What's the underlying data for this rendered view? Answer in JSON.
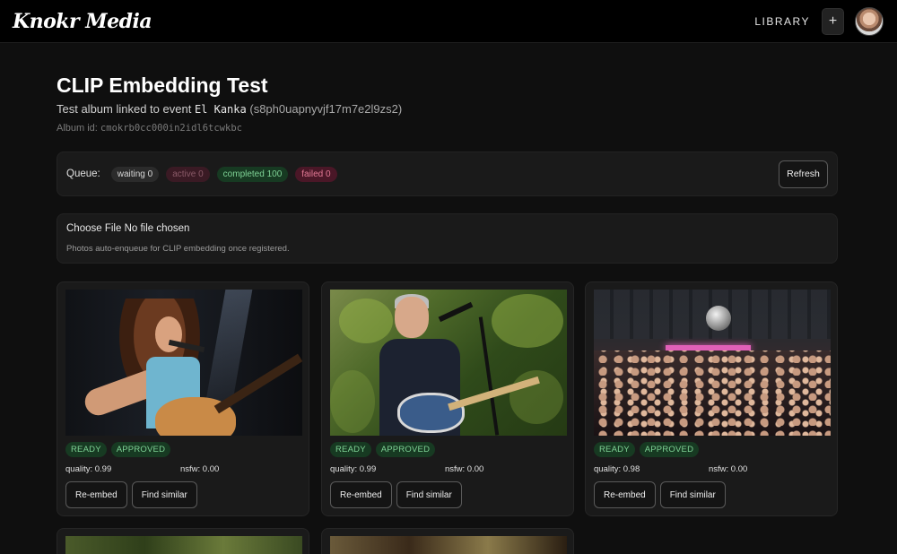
{
  "header": {
    "logo": "Knokr Media",
    "nav_library": "LIBRARY",
    "plus_label": "+"
  },
  "page": {
    "title": "CLIP Embedding Test",
    "subtitle_prefix": "Test album linked to event",
    "event_name": "El Kanka",
    "event_id": "(s8ph0uapnyvjf17m7e2l9zs2)",
    "album_id_label": "Album id:",
    "album_id": "cmokrb0cc000in2idl6tcwkbc"
  },
  "queue": {
    "label": "Queue:",
    "waiting": "waiting 0",
    "active": "active 0",
    "completed": "completed 100",
    "failed": "failed 0",
    "refresh_label": "Refresh"
  },
  "upload": {
    "choose_file": "Choose File",
    "no_file": "No file chosen",
    "hint": "Photos auto-enqueue for CLIP embedding once registered."
  },
  "cards": [
    {
      "status": "READY",
      "moderation": "APPROVED",
      "quality": "quality: 0.99",
      "nsfw": "nsfw: 0.00",
      "reembed": "Re-embed",
      "similar": "Find similar"
    },
    {
      "status": "READY",
      "moderation": "APPROVED",
      "quality": "quality: 0.99",
      "nsfw": "nsfw: 0.00",
      "reembed": "Re-embed",
      "similar": "Find similar"
    },
    {
      "status": "READY",
      "moderation": "APPROVED",
      "quality": "quality: 0.98",
      "nsfw": "nsfw: 0.00",
      "reembed": "Re-embed",
      "similar": "Find similar"
    }
  ],
  "colors": {
    "background": "#0f0f0f",
    "panel": "#1a1a1a",
    "success_bg": "#173a22",
    "success_text": "#7fd396",
    "failed_text": "#e47a96"
  }
}
